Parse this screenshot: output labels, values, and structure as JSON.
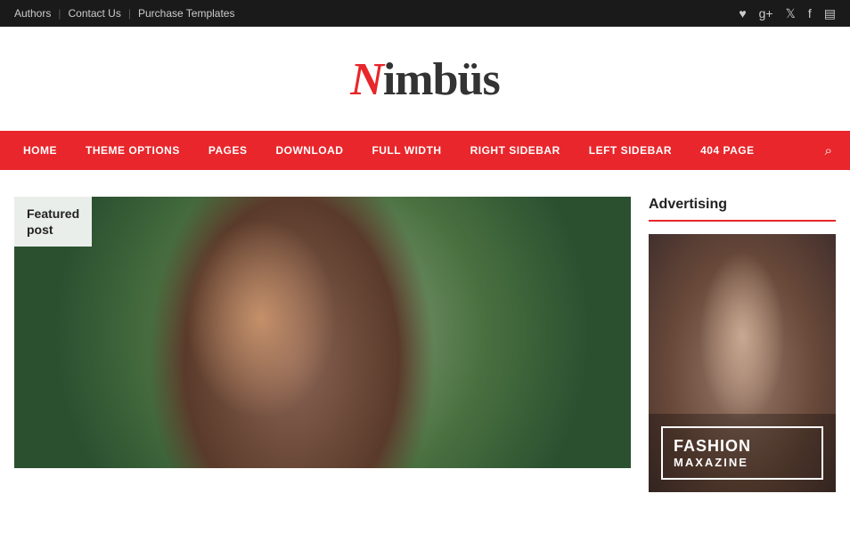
{
  "topbar": {
    "links": [
      {
        "label": "Authors"
      },
      {
        "label": "Contact Us"
      },
      {
        "label": "Purchase Templates"
      }
    ],
    "icons": [
      "instagram",
      "google-plus",
      "twitter",
      "facebook",
      "rss"
    ]
  },
  "logo": {
    "n_letter": "N",
    "rest": "imb",
    "umlaut": "ü",
    "end": "s"
  },
  "nav": {
    "items": [
      {
        "label": "HOME"
      },
      {
        "label": "THEME OPTIONS"
      },
      {
        "label": "PAGES"
      },
      {
        "label": "DOWNLOAD"
      },
      {
        "label": "FULL WIDTH"
      },
      {
        "label": "RIGHT SIDEBAR"
      },
      {
        "label": "LEFT SIDEBAR"
      },
      {
        "label": "404 PAGE"
      }
    ]
  },
  "featured": {
    "label": "Featured\npost"
  },
  "sidebar": {
    "advertising_title": "Advertising",
    "ad_title": "FASHION",
    "ad_subtitle": "MAXAZINE"
  }
}
